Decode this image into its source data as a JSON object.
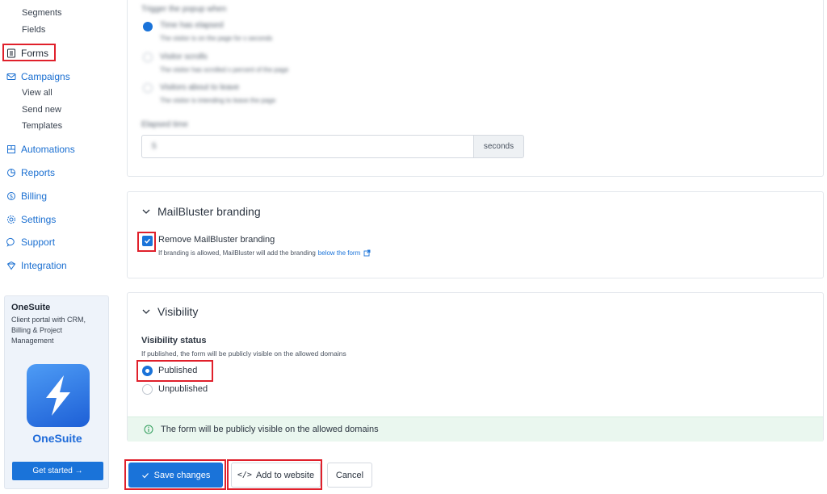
{
  "sidebar": {
    "segments": "Segments",
    "fields": "Fields",
    "forms": "Forms",
    "campaigns": "Campaigns",
    "view_all": "View all",
    "send_new": "Send new",
    "templates": "Templates",
    "automations": "Automations",
    "reports": "Reports",
    "billing": "Billing",
    "settings": "Settings",
    "support": "Support",
    "integration": "Integration"
  },
  "promo": {
    "title": "OneSuite",
    "description": "Client portal with CRM, Billing & Project Management",
    "name": "OneSuite",
    "cta": "Get started →"
  },
  "trigger": {
    "heading": "Trigger the popup when",
    "opt1_title": "Time has elapsed",
    "opt1_desc": "The visitor is on the page for x seconds",
    "opt2_title": "Visitor scrolls",
    "opt2_desc": "The visitor has scrolled x percent of the page",
    "opt3_title": "Visitors about to leave",
    "opt3_desc": "The visitor is intending to leave the page",
    "elapsed_label": "Elapsed time",
    "elapsed_value": "5",
    "seconds": "seconds"
  },
  "branding": {
    "title": "MailBluster branding",
    "checkbox_label": "Remove MailBluster branding",
    "help": "If branding is allowed, MailBluster will add the branding",
    "link": "below the form"
  },
  "visibility": {
    "title": "Visibility",
    "status_label": "Visibility status",
    "status_help": "If published, the form will be publicly visible on the allowed domains",
    "published": "Published",
    "unpublished": "Unpublished",
    "info": "The form will be publicly visible on the allowed domains"
  },
  "actions": {
    "save": "Save changes",
    "add": "Add to website",
    "cancel": "Cancel"
  },
  "colors": {
    "accent": "#1a73d9",
    "highlight": "#e0202b",
    "success_bg": "#eaf7ef"
  }
}
